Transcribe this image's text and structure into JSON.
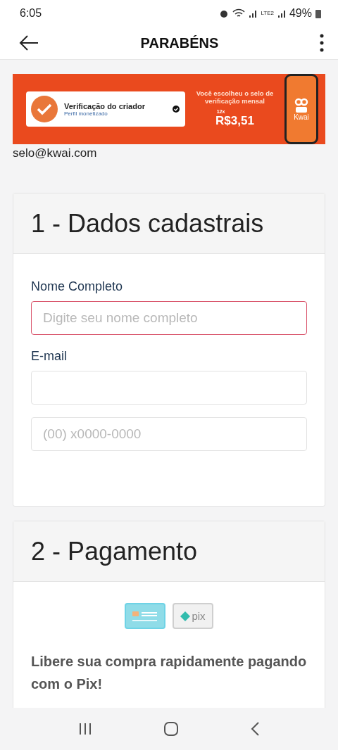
{
  "status_bar": {
    "time": "6:05",
    "network": "LTE2",
    "battery": "49%"
  },
  "app_bar": {
    "title": "PARABÉNS"
  },
  "banner": {
    "badge_title": "Verificação do criador",
    "badge_subtitle": "Perfil monetizado",
    "headline": "Você escolheu o selo de verificação mensal",
    "installments": "12x",
    "price": "R$3,51",
    "phone_label": "Kwai"
  },
  "contact_email": "selo@kwai.com",
  "sections": [
    {
      "title": "1 - Dados cadastrais",
      "fields": [
        {
          "label": "Nome Completo",
          "placeholder": "Digite seu nome completo",
          "invalid": true
        },
        {
          "label": "E-mail",
          "invalid": false
        },
        {
          "placeholder": "(00) x0000-0000",
          "invalid": false
        }
      ]
    },
    {
      "title": "2 - Pagamento",
      "methods": [
        {
          "kind": "card",
          "selected": true
        },
        {
          "kind": "pix",
          "label": "pix",
          "selected": false
        }
      ],
      "note": "Libere sua compra rapidamente pagando com o Pix!"
    }
  ]
}
